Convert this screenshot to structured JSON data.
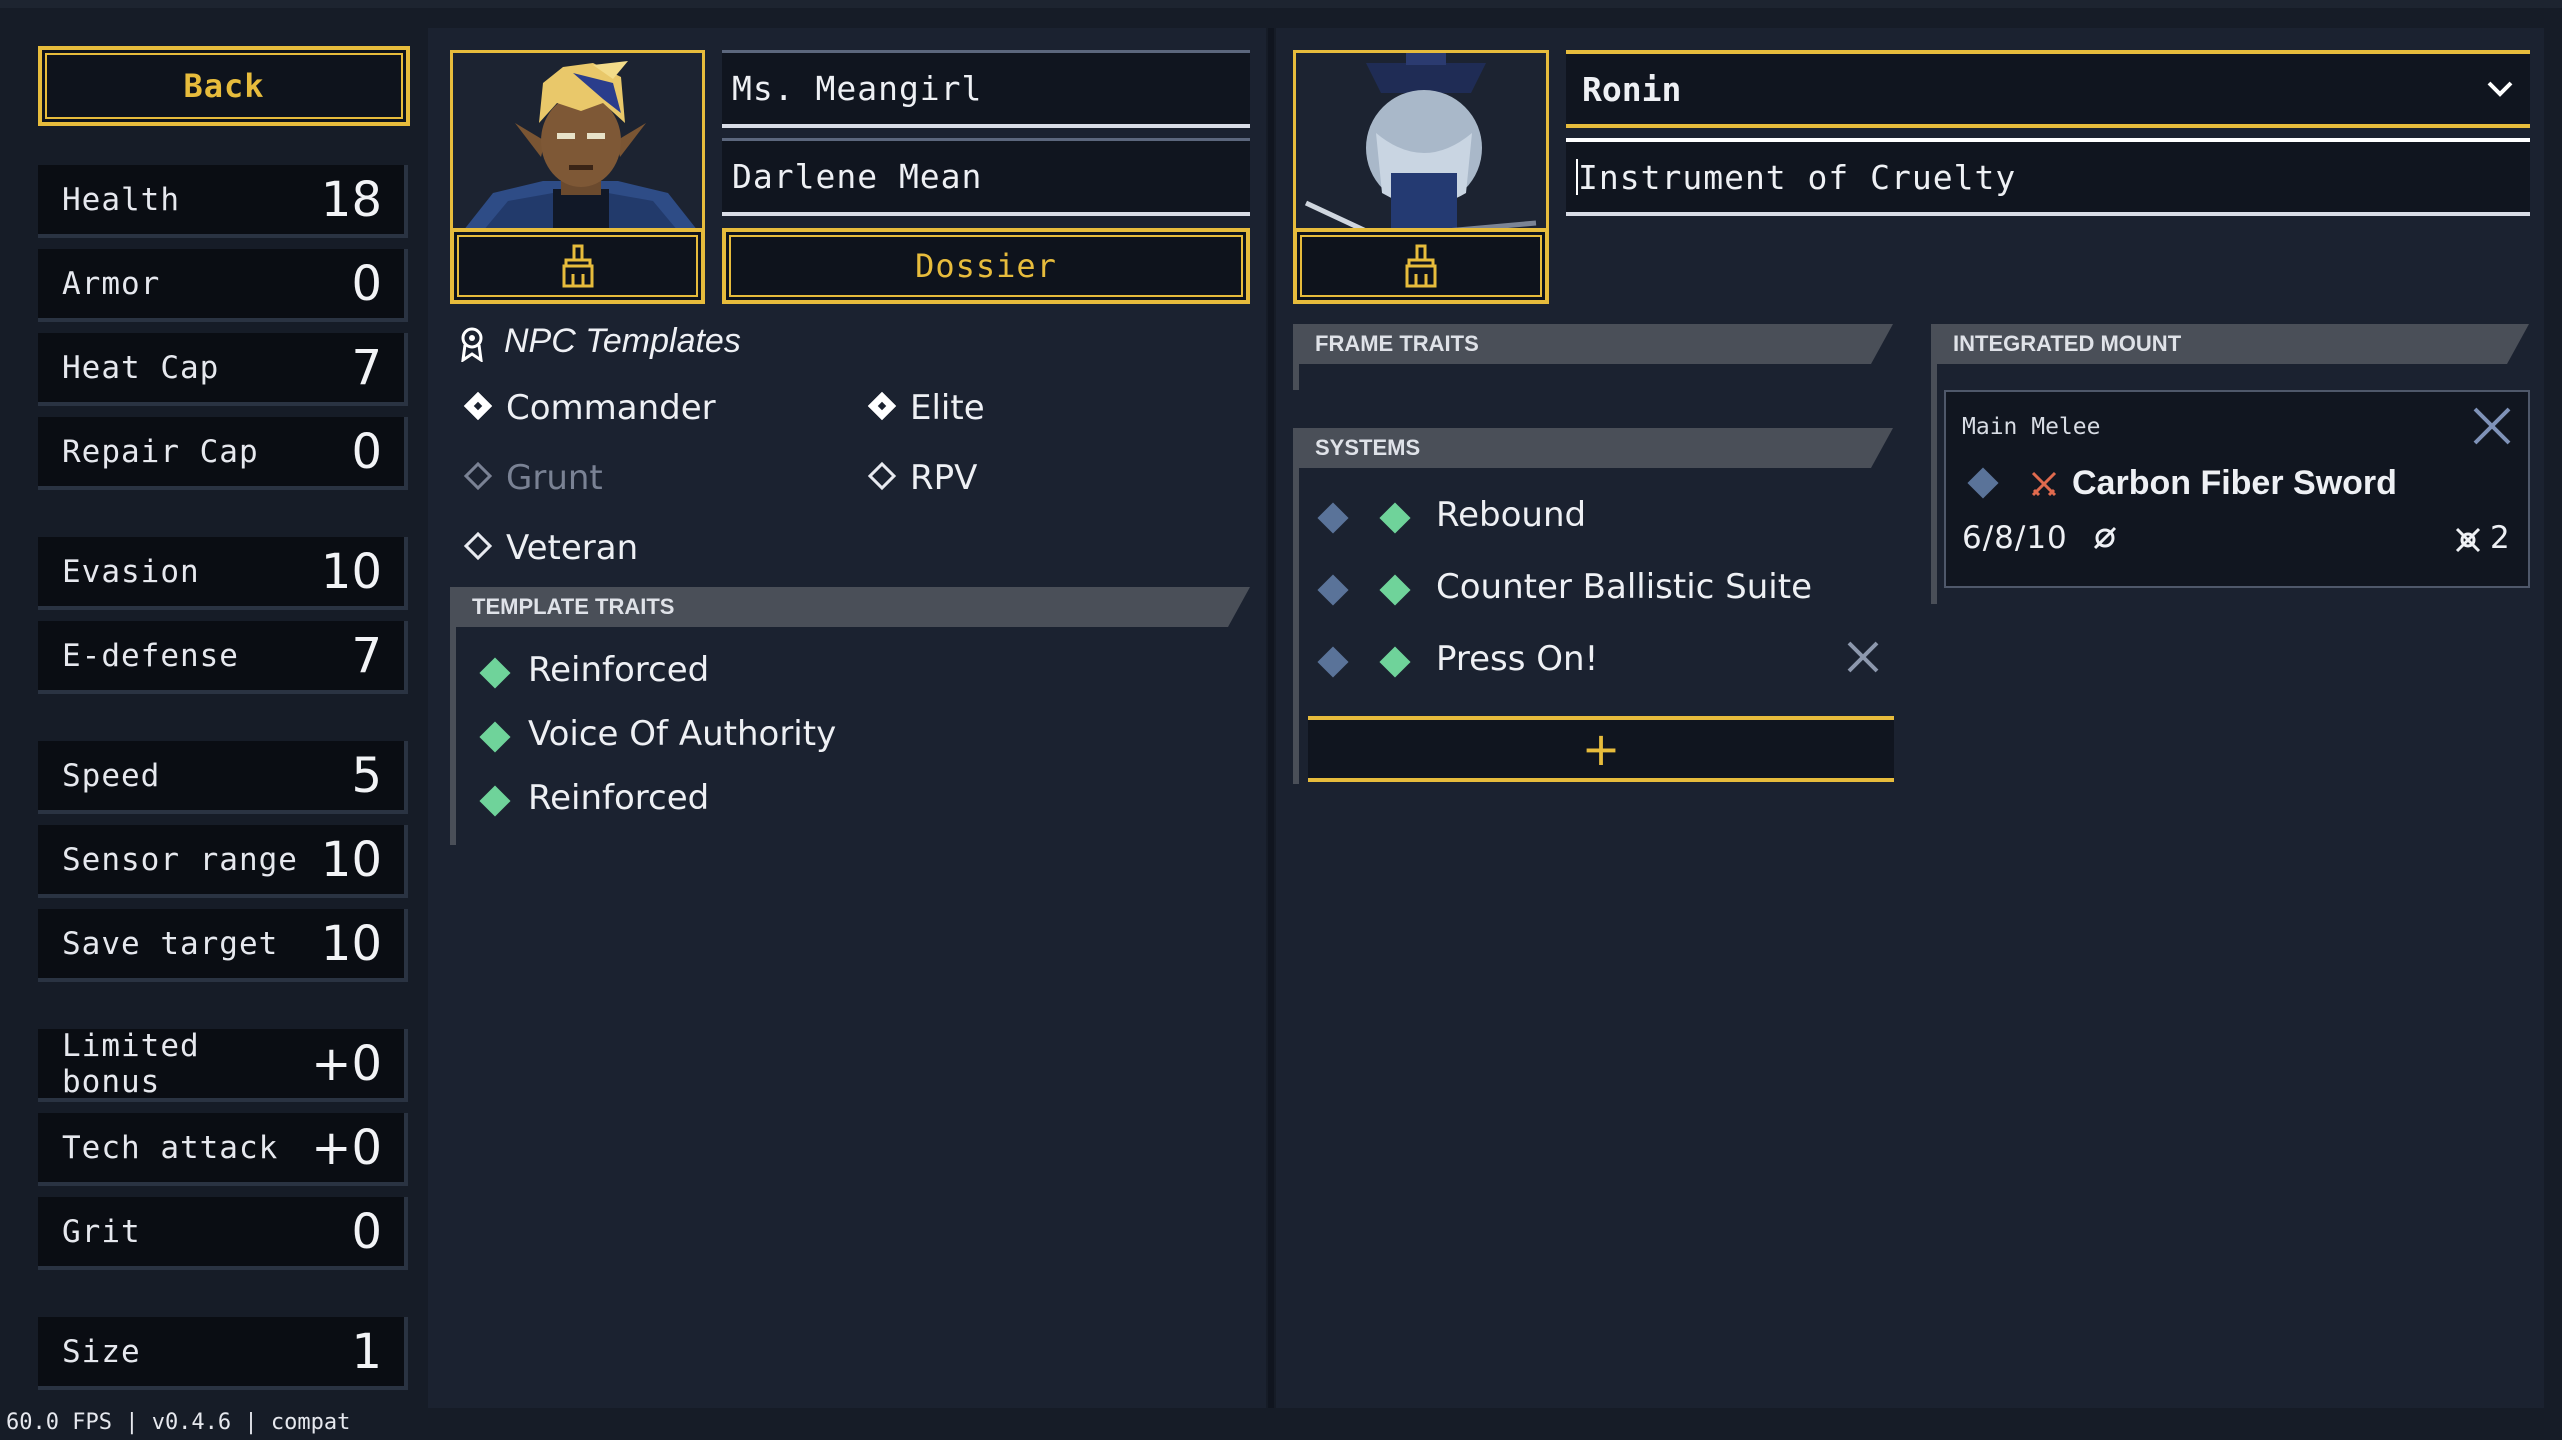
{
  "left": {
    "back_label": "Back",
    "stats": [
      {
        "label": "Health",
        "value": "18"
      },
      {
        "label": "Armor",
        "value": "0"
      },
      {
        "label": "Heat Cap",
        "value": "7"
      },
      {
        "label": "Repair Cap",
        "value": "0"
      },
      {
        "label": "Evasion",
        "value": "10"
      },
      {
        "label": "E-defense",
        "value": "7"
      },
      {
        "label": "Speed",
        "value": "5"
      },
      {
        "label": "Sensor range",
        "value": "10"
      },
      {
        "label": "Save target",
        "value": "10"
      },
      {
        "label": "Limited bonus",
        "value": "+0"
      },
      {
        "label": "Tech attack",
        "value": "+0"
      },
      {
        "label": "Grit",
        "value": "0"
      },
      {
        "label": "Size",
        "value": "1"
      }
    ]
  },
  "pilot": {
    "callsign": "Ms. Meangirl",
    "name": "Darlene Mean",
    "dossier_label": "Dossier",
    "templates_title": "NPC Templates",
    "templates": [
      {
        "label": "Commander",
        "state": "selected"
      },
      {
        "label": "Elite",
        "state": "selected"
      },
      {
        "label": "Grunt",
        "state": "disabled"
      },
      {
        "label": "RPV",
        "state": "unselected"
      },
      {
        "label": "Veteran",
        "state": "unselected"
      }
    ],
    "template_traits_header": "TEMPLATE TRAITS",
    "template_traits": [
      "Reinforced",
      "Voice Of Authority",
      "Reinforced"
    ]
  },
  "mech": {
    "frame": "Ronin",
    "mech_name": "Instrument of Cruelty",
    "frame_traits_header": "FRAME TRAITS",
    "systems_header": "SYSTEMS",
    "systems": [
      "Rebound",
      "Counter Ballistic Suite",
      "Press On!"
    ],
    "add_symbol": "+",
    "integrated_mount_header": "INTEGRATED MOUNT",
    "mount": {
      "slot": "Main Melee",
      "weapon": "Carbon Fiber Sword",
      "damage": "6/8/10",
      "range": "2"
    }
  },
  "status_bar": "60.0 FPS | v0.4.6 | compat",
  "colors": {
    "accent": "#e7bc3c",
    "background": "#161c27",
    "panel": "#1b2230",
    "system_green": "#6fd39a"
  }
}
